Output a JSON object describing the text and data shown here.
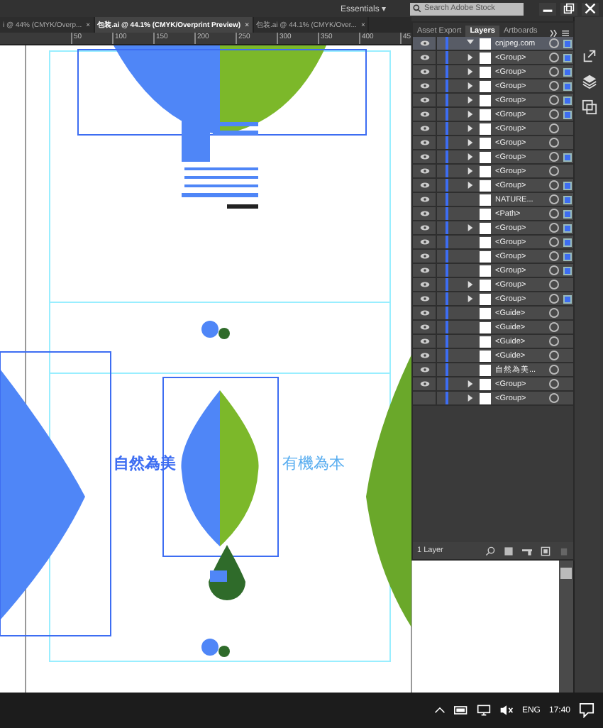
{
  "app_bar": {
    "workspace": "Essentials",
    "workspace_caret": "▾",
    "search_placeholder": "Search Adobe Stock"
  },
  "document_tabs": [
    {
      "label": "i @ 44% (CMYK/Overp...",
      "close": "×",
      "selected": false
    },
    {
      "label": "包装.ai @ 44.1% (CMYK/Overprint Preview)",
      "close": "×",
      "selected": true
    },
    {
      "label": "包装.ai @ 44.1% (CMYK/Over...",
      "close": "×",
      "selected": false
    }
  ],
  "ruler_marks": [
    "50",
    "100",
    "150",
    "200",
    "250",
    "300",
    "350",
    "400",
    "45"
  ],
  "canvas": {
    "texts": [
      "自然為美",
      "有機為本"
    ]
  },
  "layers_panel": {
    "tabs": [
      {
        "label": "Asset Export",
        "selected": false
      },
      {
        "label": "Layers",
        "selected": true
      },
      {
        "label": "Artboards",
        "selected": false
      }
    ],
    "layers": [
      {
        "name": "cnjpeg.com",
        "visible": true,
        "expanded": true,
        "selected": true,
        "children": [
          {
            "name": "<Group>",
            "kind": "container",
            "visible": true,
            "selected": true
          },
          {
            "name": "<Group>",
            "kind": "container",
            "visible": true,
            "selected": true
          },
          {
            "name": "<Group>",
            "kind": "container",
            "visible": true,
            "selected": true
          },
          {
            "name": "<Group>",
            "kind": "container",
            "visible": true,
            "selected": true
          },
          {
            "name": "<Group>",
            "kind": "container",
            "visible": true,
            "selected": true
          },
          {
            "name": "<Group>",
            "kind": "container",
            "visible": true,
            "selected": false
          },
          {
            "name": "<Group>",
            "kind": "container",
            "visible": true,
            "selected": false
          },
          {
            "name": "<Group>",
            "kind": "container",
            "visible": true,
            "selected": true
          },
          {
            "name": "<Group>",
            "kind": "container",
            "visible": true,
            "selected": false
          },
          {
            "name": "<Group>",
            "kind": "container",
            "visible": true,
            "selected": true
          },
          {
            "name": "NATURE...",
            "kind": "item",
            "visible": true,
            "selected": true
          },
          {
            "name": "<Path>",
            "kind": "item",
            "visible": true,
            "selected": true
          },
          {
            "name": "<Group>",
            "kind": "container",
            "visible": true,
            "selected": true
          },
          {
            "name": "<Group>",
            "kind": "item",
            "visible": true,
            "selected": true
          },
          {
            "name": "<Group>",
            "kind": "item",
            "visible": true,
            "selected": true
          },
          {
            "name": "<Group>",
            "kind": "item",
            "visible": true,
            "selected": true
          },
          {
            "name": "<Group>",
            "kind": "container",
            "visible": true,
            "selected": false
          },
          {
            "name": "<Group>",
            "kind": "container",
            "visible": true,
            "selected": true
          },
          {
            "name": "<Guide>",
            "kind": "item",
            "visible": true,
            "selected": false
          },
          {
            "name": "<Guide>",
            "kind": "item",
            "visible": true,
            "selected": false
          },
          {
            "name": "<Guide>",
            "kind": "item",
            "visible": true,
            "selected": false
          },
          {
            "name": "<Guide>",
            "kind": "item",
            "visible": true,
            "selected": false
          },
          {
            "name": "自然為美...",
            "kind": "item",
            "visible": true,
            "selected": false
          },
          {
            "name": "<Group>",
            "kind": "container",
            "visible": true,
            "selected": false
          },
          {
            "name": "<Group>",
            "kind": "container",
            "visible": false,
            "selected": false
          }
        ]
      }
    ],
    "footer": "1 Layer"
  },
  "taskbar": {
    "language": "ENG",
    "time": "17:40"
  }
}
